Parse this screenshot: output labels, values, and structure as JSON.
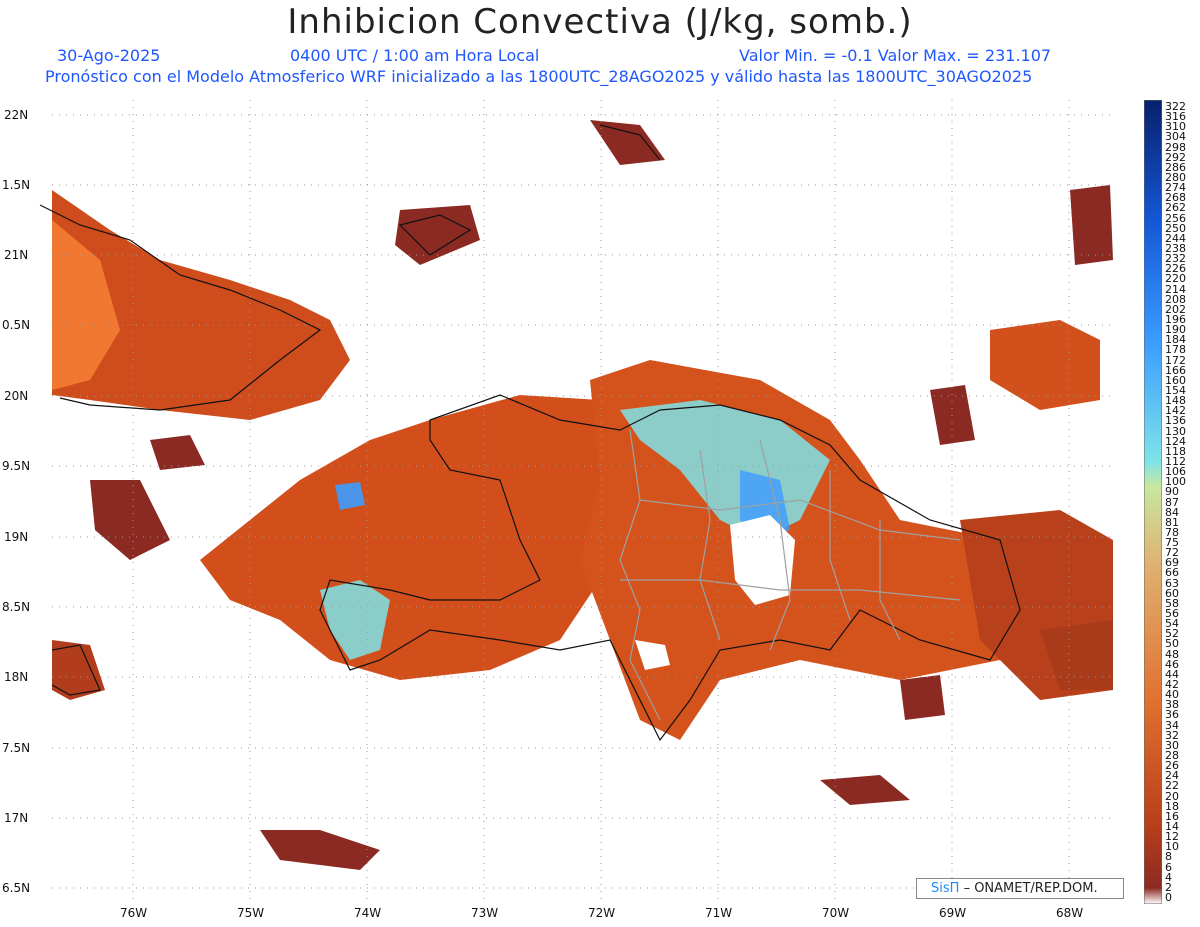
{
  "title": "Inhibicion Convectiva (J/kg, somb.)",
  "date": "30-Ago-2025",
  "time": "0400 UTC / 1:00 am Hora Local",
  "minmax": "Valor Min. = -0.1  Valor Max. = 231.107",
  "forecast": "Pronóstico con el Modelo Atmosferico WRF inicializado a las 1800UTC_28AGO2025 y válido hasta las  1800UTC_30AGO2025",
  "credit": {
    "brand": "SisΠ",
    "org": "– ONAMET/REP.DOM."
  },
  "lat_labels": [
    "22N",
    "1.5N",
    "21N",
    "0.5N",
    "20N",
    "9.5N",
    "19N",
    "8.5N",
    "18N",
    "7.5N",
    "17N",
    "6.5N"
  ],
  "lon_labels": [
    "76W",
    "75W",
    "74W",
    "73W",
    "72W",
    "71W",
    "70W",
    "69W",
    "68W"
  ],
  "colorbar_labels": [
    "322",
    "316",
    "310",
    "304",
    "298",
    "292",
    "286",
    "280",
    "274",
    "268",
    "262",
    "256",
    "250",
    "244",
    "238",
    "232",
    "226",
    "220",
    "214",
    "208",
    "202",
    "196",
    "190",
    "184",
    "178",
    "172",
    "166",
    "160",
    "154",
    "148",
    "142",
    "136",
    "130",
    "124",
    "118",
    "112",
    "106",
    "100",
    "90",
    "87",
    "84",
    "81",
    "78",
    "75",
    "72",
    "69",
    "66",
    "63",
    "60",
    "58",
    "56",
    "54",
    "52",
    "50",
    "48",
    "46",
    "44",
    "42",
    "40",
    "38",
    "36",
    "34",
    "32",
    "30",
    "28",
    "26",
    "24",
    "22",
    "20",
    "18",
    "16",
    "14",
    "12",
    "10",
    "8",
    "6",
    "4",
    "2",
    "0"
  ],
  "colors": {
    "low": "#8b2a22",
    "mid": "#d9541c",
    "high": "#ff6a10",
    "cyan": "#7fe3e8",
    "blue": "#3d9bff",
    "text_blue": "#1f57ff"
  }
}
